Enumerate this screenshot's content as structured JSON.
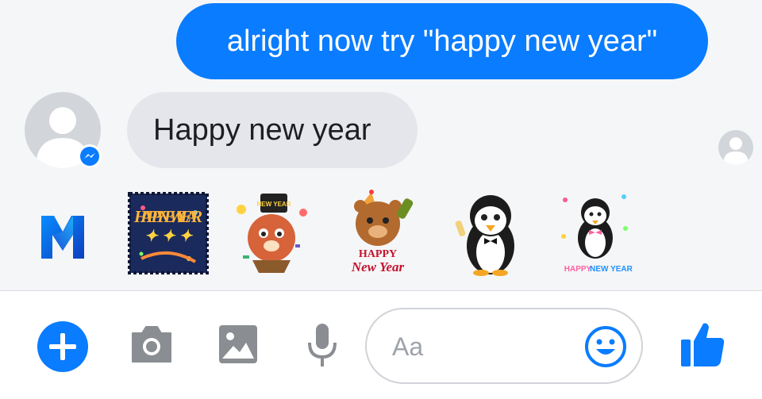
{
  "conversation": {
    "outgoing_message": "alright now try \"happy new year\"",
    "incoming_message": "Happy new year"
  },
  "stickers": [
    {
      "label": "Happy New Year stamp sticker",
      "icon": "happy-new-year-stamp"
    },
    {
      "label": "New Year party bear sticker",
      "icon": "new-year-bear"
    },
    {
      "label": "Happy New Year bear sticker",
      "icon": "happy-new-year-bear"
    },
    {
      "label": "Tuxedo penguin sticker",
      "icon": "penguin-tuxedo"
    },
    {
      "label": "Happy New Year penguin sticker",
      "icon": "happy-new-year-penguin"
    }
  ],
  "sticker_text": {
    "stamp": "HAPPY NEW YEAR",
    "bear_hat": "NEW YEAR",
    "bear2_line1": "HAPPY",
    "bear2_line2": "New Year",
    "penguin_happy": "HAPPY",
    "penguin_newyear": "NEW YEAR"
  },
  "composer": {
    "placeholder": "Aa"
  },
  "colors": {
    "accent": "#0a7cff",
    "incoming_bubble": "#e4e6eb",
    "toolbar_icon_gray": "#8a8d91"
  }
}
